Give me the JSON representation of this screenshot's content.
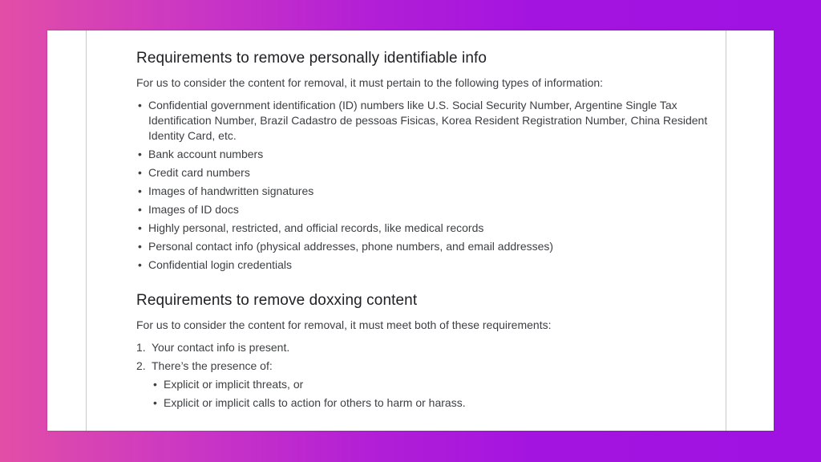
{
  "sections": [
    {
      "heading": "Requirements to remove personally identifiable info",
      "intro": "For us to consider the content for removal, it must pertain to the following types of information:",
      "items": [
        "Confidential government identification (ID) numbers like U.S. Social Security Number, Argentine Single Tax Identification Number, Brazil Cadastro de pessoas Fisicas, Korea Resident Registration Number, China Resident Identity Card, etc.",
        "Bank account numbers",
        "Credit card numbers",
        "Images of handwritten signatures",
        "Images of ID docs",
        "Highly personal, restricted, and official records, like medical records",
        "Personal contact info (physical addresses, phone numbers, and email addresses)",
        "Confidential login credentials"
      ]
    },
    {
      "heading": "Requirements to remove doxxing content",
      "intro": "For us to consider the content for removal, it must meet both of these requirements:",
      "numbered": [
        {
          "num": "1.",
          "text": "Your contact info is present."
        },
        {
          "num": "2.",
          "text": "There’s the presence of:",
          "sub": [
            "Explicit or implicit threats, or",
            "Explicit or implicit calls to action for others to harm or harass."
          ]
        }
      ]
    }
  ],
  "colors": {
    "gradient_left": "#e24ea6",
    "gradient_right": "#9f12e2",
    "card": "#ffffff",
    "heading_text": "#202124",
    "body_text": "#3c4043"
  }
}
